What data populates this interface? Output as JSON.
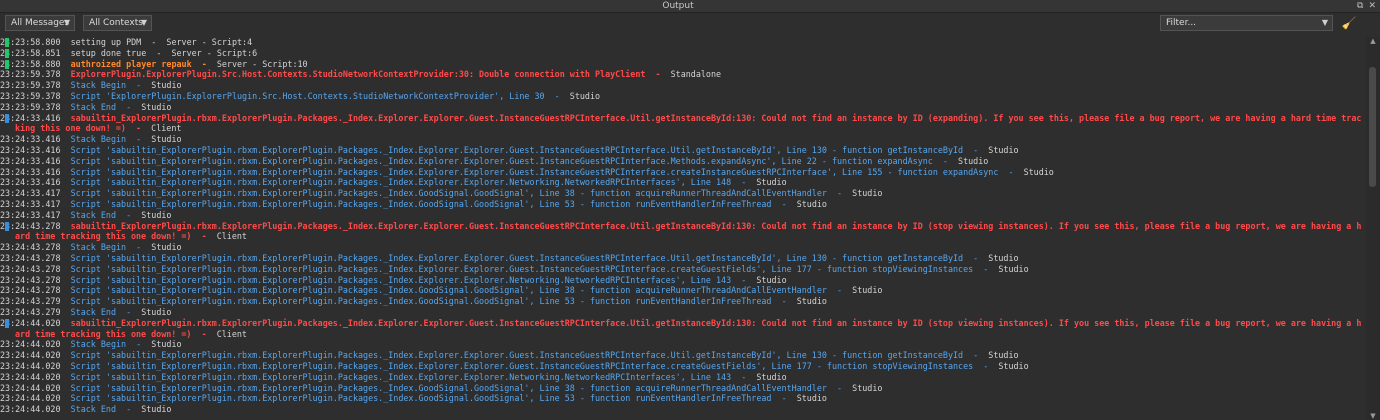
{
  "window": {
    "title": "Output"
  },
  "toolbar": {
    "messages_dropdown": "All Messages",
    "contexts_dropdown": "All Contexts",
    "filter_placeholder": "Filter..."
  },
  "colors": {
    "error": "#ff4a4a",
    "warning": "#ff8a2e",
    "info": "#56a7f0",
    "normal": "#d4d4d4",
    "marker_green": "#27c46a",
    "marker_blue": "#3a8ed8"
  },
  "log": [
    {
      "ts": "23:23:58.800",
      "msg": "setting up PDM",
      "src": "Server - Script:4",
      "kind": "normal",
      "mark": "green"
    },
    {
      "ts": "23:23:58.851",
      "msg": "setup done true",
      "src": "Server - Script:6",
      "kind": "normal",
      "mark": "green"
    },
    {
      "ts": "23:23:58.880",
      "msg": "authroized player repauk",
      "src": "Server - Script:10",
      "kind": "warn",
      "mark": "green"
    },
    {
      "ts": "23:23:59.378",
      "msg": "ExplorerPlugin.ExplorerPlugin.Src.Host.Contexts.StudioNetworkContextProvider:30: Double connection with PlayClient",
      "src": "Standalone",
      "kind": "err",
      "mark": ""
    },
    {
      "ts": "23:23:59.378",
      "msg": "Stack Begin",
      "src": "Studio",
      "kind": "info",
      "mark": ""
    },
    {
      "ts": "23:23:59.378",
      "msg": "Script 'ExplorerPlugin.ExplorerPlugin.Src.Host.Contexts.StudioNetworkContextProvider', Line 30",
      "src": "Studio",
      "kind": "info",
      "mark": ""
    },
    {
      "ts": "23:23:59.378",
      "msg": "Stack End",
      "src": "Studio",
      "kind": "info",
      "mark": ""
    },
    {
      "ts": "23:24:33.416",
      "msg": "sabuiltin_ExplorerPlugin.rbxm.ExplorerPlugin.Packages._Index.Explorer.Explorer.Guest.InstanceGuestRPCInterface.Util.getInstanceById:130: Could not find an instance by ID (expanding). If you see this, please file a bug report, we are having a hard time tracking this one down! =)",
      "src": "Client",
      "kind": "err",
      "mark": "blue"
    },
    {
      "ts": "23:24:33.416",
      "msg": "Stack Begin",
      "src": "Studio",
      "kind": "info",
      "mark": ""
    },
    {
      "ts": "23:24:33.416",
      "msg": "Script 'sabuiltin_ExplorerPlugin.rbxm.ExplorerPlugin.Packages._Index.Explorer.Explorer.Guest.InstanceGuestRPCInterface.Util.getInstanceById', Line 130 - function getInstanceById",
      "src": "Studio",
      "kind": "info",
      "mark": ""
    },
    {
      "ts": "23:24:33.416",
      "msg": "Script 'sabuiltin_ExplorerPlugin.rbxm.ExplorerPlugin.Packages._Index.Explorer.Explorer.Guest.InstanceGuestRPCInterface.Methods.expandAsync', Line 22 - function expandAsync",
      "src": "Studio",
      "kind": "info",
      "mark": ""
    },
    {
      "ts": "23:24:33.416",
      "msg": "Script 'sabuiltin_ExplorerPlugin.rbxm.ExplorerPlugin.Packages._Index.Explorer.Explorer.Guest.InstanceGuestRPCInterface.createInstanceGuestRPCInterface', Line 155 - function expandAsync",
      "src": "Studio",
      "kind": "info",
      "mark": ""
    },
    {
      "ts": "23:24:33.416",
      "msg": "Script 'sabuiltin_ExplorerPlugin.rbxm.ExplorerPlugin.Packages._Index.Explorer.Explorer.Networking.NetworkedRPCInterfaces', Line 148",
      "src": "Studio",
      "kind": "info",
      "mark": ""
    },
    {
      "ts": "23:24:33.417",
      "msg": "Script 'sabuiltin_ExplorerPlugin.rbxm.ExplorerPlugin.Packages._Index.GoodSignal.GoodSignal', Line 38 - function acquireRunnerThreadAndCallEventHandler",
      "src": "Studio",
      "kind": "info",
      "mark": ""
    },
    {
      "ts": "23:24:33.417",
      "msg": "Script 'sabuiltin_ExplorerPlugin.rbxm.ExplorerPlugin.Packages._Index.GoodSignal.GoodSignal', Line 53 - function runEventHandlerInFreeThread",
      "src": "Studio",
      "kind": "info",
      "mark": ""
    },
    {
      "ts": "23:24:33.417",
      "msg": "Stack End",
      "src": "Studio",
      "kind": "info",
      "mark": ""
    },
    {
      "ts": "23:24:43.278",
      "msg": "sabuiltin_ExplorerPlugin.rbxm.ExplorerPlugin.Packages._Index.Explorer.Explorer.Guest.InstanceGuestRPCInterface.Util.getInstanceById:130: Could not find an instance by ID (stop viewing instances). If you see this, please file a bug report, we are having a hard time tracking this one down! =)",
      "src": "Client",
      "kind": "err",
      "mark": "blue"
    },
    {
      "ts": "23:24:43.278",
      "msg": "Stack Begin",
      "src": "Studio",
      "kind": "info",
      "mark": ""
    },
    {
      "ts": "23:24:43.278",
      "msg": "Script 'sabuiltin_ExplorerPlugin.rbxm.ExplorerPlugin.Packages._Index.Explorer.Explorer.Guest.InstanceGuestRPCInterface.Util.getInstanceById', Line 130 - function getInstanceById",
      "src": "Studio",
      "kind": "info",
      "mark": ""
    },
    {
      "ts": "23:24:43.278",
      "msg": "Script 'sabuiltin_ExplorerPlugin.rbxm.ExplorerPlugin.Packages._Index.Explorer.Explorer.Guest.InstanceGuestRPCInterface.createGuestFields', Line 177 - function stopViewingInstances",
      "src": "Studio",
      "kind": "info",
      "mark": ""
    },
    {
      "ts": "23:24:43.278",
      "msg": "Script 'sabuiltin_ExplorerPlugin.rbxm.ExplorerPlugin.Packages._Index.Explorer.Explorer.Networking.NetworkedRPCInterfaces', Line 143",
      "src": "Studio",
      "kind": "info",
      "mark": ""
    },
    {
      "ts": "23:24:43.278",
      "msg": "Script 'sabuiltin_ExplorerPlugin.rbxm.ExplorerPlugin.Packages._Index.GoodSignal.GoodSignal', Line 38 - function acquireRunnerThreadAndCallEventHandler",
      "src": "Studio",
      "kind": "info",
      "mark": ""
    },
    {
      "ts": "23:24:43.279",
      "msg": "Script 'sabuiltin_ExplorerPlugin.rbxm.ExplorerPlugin.Packages._Index.GoodSignal.GoodSignal', Line 53 - function runEventHandlerInFreeThread",
      "src": "Studio",
      "kind": "info",
      "mark": ""
    },
    {
      "ts": "23:24:43.279",
      "msg": "Stack End",
      "src": "Studio",
      "kind": "info",
      "mark": ""
    },
    {
      "ts": "23:24:44.020",
      "msg": "sabuiltin_ExplorerPlugin.rbxm.ExplorerPlugin.Packages._Index.Explorer.Explorer.Guest.InstanceGuestRPCInterface.Util.getInstanceById:130: Could not find an instance by ID (stop viewing instances). If you see this, please file a bug report, we are having a hard time tracking this one down! =)",
      "src": "Client",
      "kind": "err",
      "mark": "blue"
    },
    {
      "ts": "23:24:44.020",
      "msg": "Stack Begin",
      "src": "Studio",
      "kind": "info",
      "mark": ""
    },
    {
      "ts": "23:24:44.020",
      "msg": "Script 'sabuiltin_ExplorerPlugin.rbxm.ExplorerPlugin.Packages._Index.Explorer.Explorer.Guest.InstanceGuestRPCInterface.Util.getInstanceById', Line 130 - function getInstanceById",
      "src": "Studio",
      "kind": "info",
      "mark": ""
    },
    {
      "ts": "23:24:44.020",
      "msg": "Script 'sabuiltin_ExplorerPlugin.rbxm.ExplorerPlugin.Packages._Index.Explorer.Explorer.Guest.InstanceGuestRPCInterface.createGuestFields', Line 177 - function stopViewingInstances",
      "src": "Studio",
      "kind": "info",
      "mark": ""
    },
    {
      "ts": "23:24:44.020",
      "msg": "Script 'sabuiltin_ExplorerPlugin.rbxm.ExplorerPlugin.Packages._Index.Explorer.Explorer.Networking.NetworkedRPCInterfaces', Line 143",
      "src": "Studio",
      "kind": "info",
      "mark": ""
    },
    {
      "ts": "23:24:44.020",
      "msg": "Script 'sabuiltin_ExplorerPlugin.rbxm.ExplorerPlugin.Packages._Index.GoodSignal.GoodSignal', Line 38 - function acquireRunnerThreadAndCallEventHandler",
      "src": "Studio",
      "kind": "info",
      "mark": ""
    },
    {
      "ts": "23:24:44.020",
      "msg": "Script 'sabuiltin_ExplorerPlugin.rbxm.ExplorerPlugin.Packages._Index.GoodSignal.GoodSignal', Line 53 - function runEventHandlerInFreeThread",
      "src": "Studio",
      "kind": "info",
      "mark": ""
    },
    {
      "ts": "23:24:44.020",
      "msg": "Stack End",
      "src": "Studio",
      "kind": "info",
      "mark": ""
    }
  ]
}
